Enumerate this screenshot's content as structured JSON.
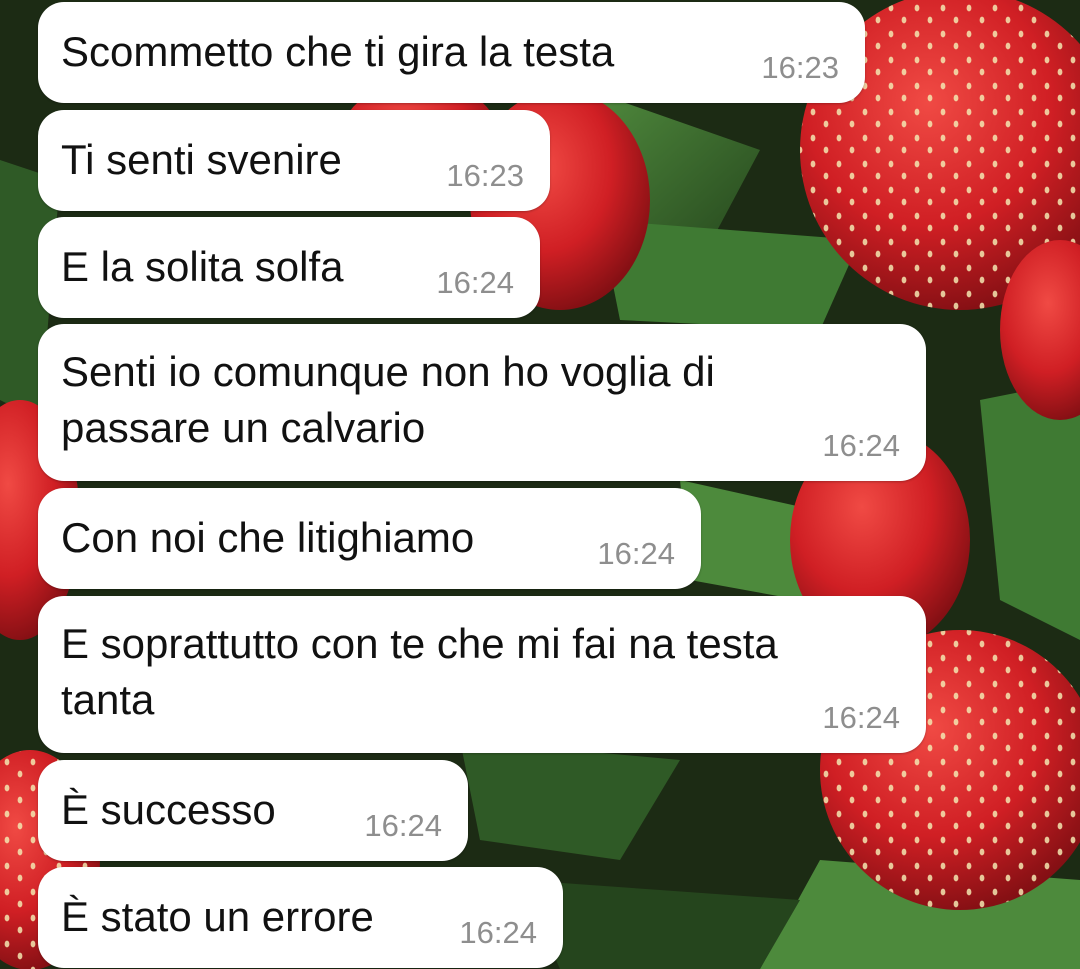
{
  "wallpaper": {
    "description_icon": "strawberries-wallpaper",
    "colors": {
      "strawberry": "#d8262a",
      "strawberry_dark": "#9c1417",
      "leaf": "#3f7a33",
      "leaf_dark": "#1f3d18",
      "seed": "#f3e6b0"
    }
  },
  "bubble_color": "#ffffff",
  "time_color": "#8e8e8e",
  "messages": [
    {
      "text": "Scommetto che ti gira la testa",
      "time": "16:23"
    },
    {
      "text": "Ti senti svenire",
      "time": "16:23"
    },
    {
      "text": "E la solita solfa",
      "time": "16:24"
    },
    {
      "text": "Senti io comunque non ho voglia di\npassare un calvario",
      "time": "16:24"
    },
    {
      "text": "Con noi che litighiamo",
      "time": "16:24"
    },
    {
      "text": "E soprattutto con te che mi fai na testa\ntanta",
      "time": "16:24"
    },
    {
      "text": "È successo",
      "time": "16:24"
    },
    {
      "text": "È stato un errore",
      "time": "16:24"
    }
  ]
}
